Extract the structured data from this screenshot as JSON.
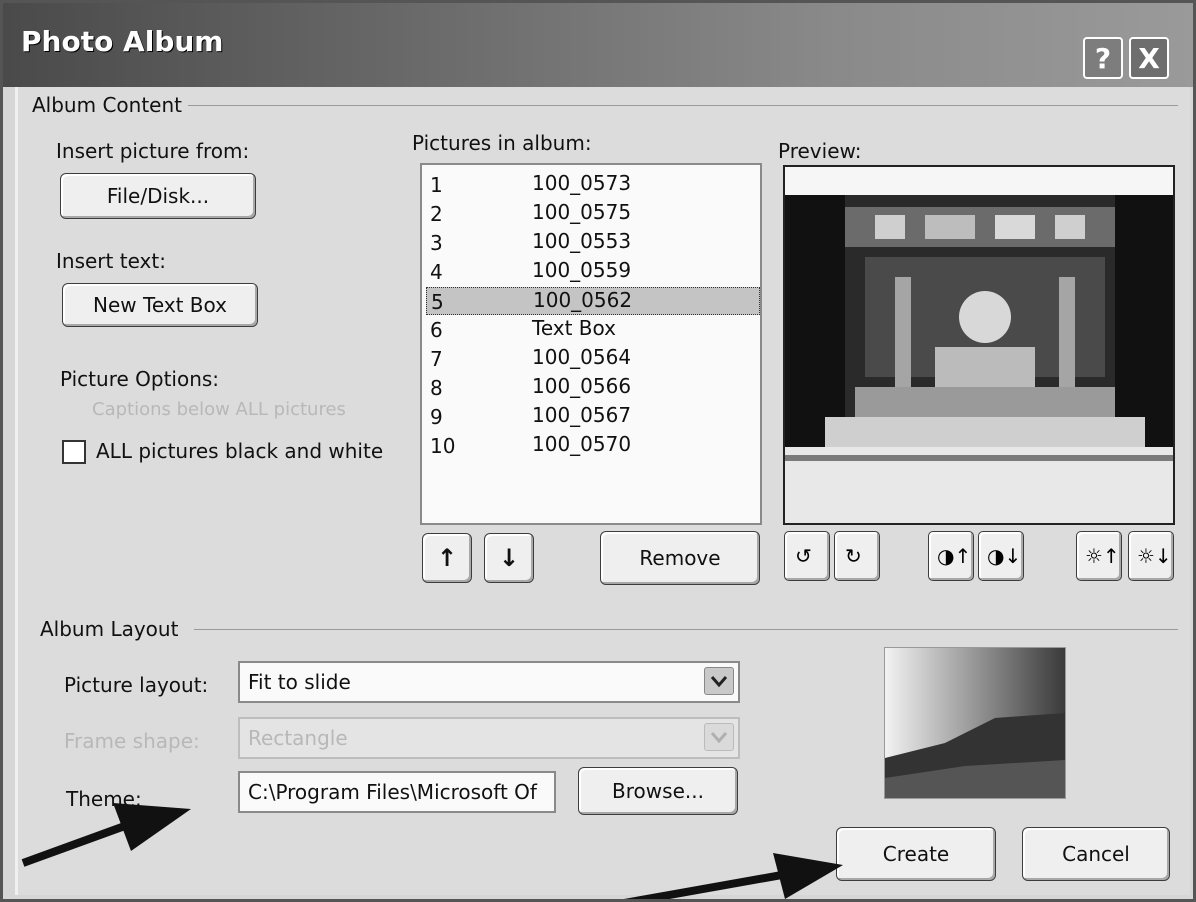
{
  "window": {
    "title": "Photo Album",
    "help_symbol": "?",
    "close_symbol": "X"
  },
  "album_content": {
    "group_label": "Album Content",
    "insert_picture_label": "Insert picture from:",
    "file_disk_button": "File/Disk...",
    "insert_text_label": "Insert text:",
    "new_text_box_button": "New Text Box",
    "picture_options_label": "Picture Options:",
    "captions_option": "Captions below ALL pictures",
    "black_white_option": "ALL pictures black and white",
    "black_white_checked": false,
    "pictures_label": "Pictures in album:",
    "pictures": [
      {
        "num": "1",
        "name": "100_0573"
      },
      {
        "num": "2",
        "name": "100_0575"
      },
      {
        "num": "3",
        "name": "100_0553"
      },
      {
        "num": "4",
        "name": "100_0559"
      },
      {
        "num": "5",
        "name": "100_0562",
        "selected": true
      },
      {
        "num": "6",
        "name": "Text Box"
      },
      {
        "num": "7",
        "name": "100_0564"
      },
      {
        "num": "8",
        "name": "100_0566"
      },
      {
        "num": "9",
        "name": "100_0567"
      },
      {
        "num": "10",
        "name": "100_0570"
      }
    ],
    "move_up_symbol": "↑",
    "move_down_symbol": "↓",
    "remove_button": "Remove",
    "preview_label": "Preview:",
    "preview_tools": [
      "rotate-left-icon",
      "rotate-right-icon",
      "contrast-up-icon",
      "contrast-down-icon",
      "brightness-up-icon",
      "brightness-down-icon"
    ]
  },
  "album_layout": {
    "group_label": "Album Layout",
    "picture_layout_label": "Picture layout:",
    "picture_layout_value": "Fit to slide",
    "frame_shape_label": "Frame shape:",
    "frame_shape_value": "Rectangle",
    "theme_label": "Theme:",
    "theme_value": "C:\\Program Files\\Microsoft Of",
    "browse_button": "Browse..."
  },
  "footer": {
    "create_button": "Create",
    "cancel_button": "Cancel"
  }
}
